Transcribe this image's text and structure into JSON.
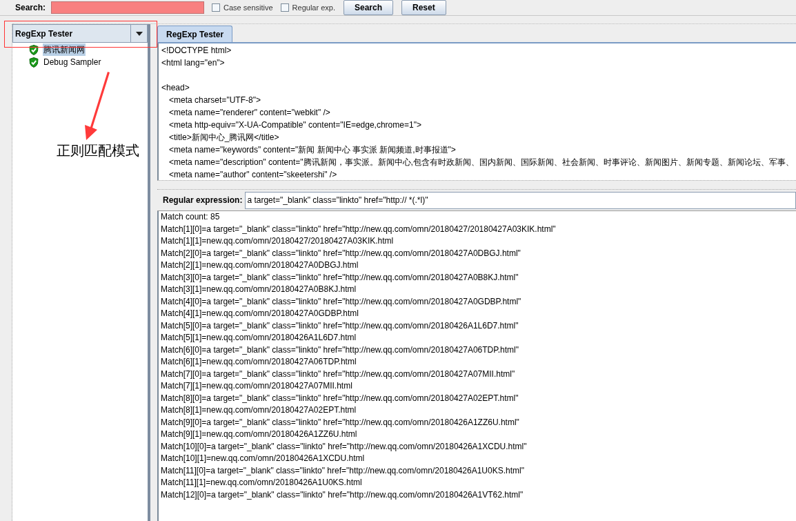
{
  "search": {
    "label": "Search:",
    "options": [
      {
        "label": "Case sensitive",
        "checked": false
      },
      {
        "label": "Regular exp.",
        "checked": false
      }
    ],
    "buttons": [
      "Search",
      "Reset"
    ]
  },
  "view_selector": {
    "value": "RegExp Tester"
  },
  "tree": [
    {
      "label": "腾讯新闻网",
      "selected": true
    },
    {
      "label": "Debug Sampler",
      "selected": false
    }
  ],
  "tabs": [
    {
      "label": "RegExp Tester",
      "selected": true
    }
  ],
  "response": {
    "blocks": [
      [
        {
          "text": "<!DOCTYPE html>",
          "indented": false
        },
        {
          "text": "<html lang=\"en\">",
          "indented": false
        }
      ],
      [
        {
          "text": "<head>",
          "indented": false
        },
        {
          "text": "<meta charset=\"UTF-8\">",
          "indented": true
        },
        {
          "text": "<meta name=\"renderer\" content=\"webkit\" />",
          "indented": true
        },
        {
          "text": "<meta http-equiv=\"X-UA-Compatible\" content=\"IE=edge,chrome=1\">",
          "indented": true
        },
        {
          "text": "<title>新闻中心_腾讯网</title>",
          "indented": true
        },
        {
          "text": "<meta name=\"keywords\" content=\"新闻 新闻中心 事实派 新闻频道,时事报道\">",
          "indented": true
        },
        {
          "text": "<meta name=\"description\" content=\"腾讯新闻，事实派。新闻中心,包含有时政新闻、国内新闻、国际新闻、社会新闻、时事评论、新闻图片、新闻专题、新闻论坛、军事、",
          "indented": true
        },
        {
          "text": "<meta name=\"author\" content=\"skeetershi\" />",
          "indented": true
        }
      ]
    ]
  },
  "regex": {
    "label": "Regular expression:",
    "value": "a target=\"_blank\" class=\"linkto\" href=\"http:// *(.*l)\""
  },
  "results": [
    "Match count: 85",
    "Match[1][0]=a target=\"_blank\" class=\"linkto\" href=\"http://new.qq.com/omn/20180427/20180427A03KIK.html\"",
    "Match[1][1]=new.qq.com/omn/20180427/20180427A03KIK.html",
    "Match[2][0]=a target=\"_blank\" class=\"linkto\" href=\"http://new.qq.com/omn/20180427A0DBGJ.html\"",
    "Match[2][1]=new.qq.com/omn/20180427A0DBGJ.html",
    "Match[3][0]=a target=\"_blank\" class=\"linkto\" href=\"http://new.qq.com/omn/20180427A0B8KJ.html\"",
    "Match[3][1]=new.qq.com/omn/20180427A0B8KJ.html",
    "Match[4][0]=a target=\"_blank\" class=\"linkto\" href=\"http://new.qq.com/omn/20180427A0GDBP.html\"",
    "Match[4][1]=new.qq.com/omn/20180427A0GDBP.html",
    "Match[5][0]=a target=\"_blank\" class=\"linkto\" href=\"http://new.qq.com/omn/20180426A1L6D7.html\"",
    "Match[5][1]=new.qq.com/omn/20180426A1L6D7.html",
    "Match[6][0]=a target=\"_blank\" class=\"linkto\" href=\"http://new.qq.com/omn/20180427A06TDP.html\"",
    "Match[6][1]=new.qq.com/omn/20180427A06TDP.html",
    "Match[7][0]=a target=\"_blank\" class=\"linkto\" href=\"http://new.qq.com/omn/20180427A07MII.html\"",
    "Match[7][1]=new.qq.com/omn/20180427A07MII.html",
    "Match[8][0]=a target=\"_blank\" class=\"linkto\" href=\"http://new.qq.com/omn/20180427A02EPT.html\"",
    "Match[8][1]=new.qq.com/omn/20180427A02EPT.html",
    "Match[9][0]=a target=\"_blank\" class=\"linkto\" href=\"http://new.qq.com/omn/20180426A1ZZ6U.html\"",
    "Match[9][1]=new.qq.com/omn/20180426A1ZZ6U.html",
    "Match[10][0]=a target=\"_blank\" class=\"linkto\" href=\"http://new.qq.com/omn/20180426A1XCDU.html\"",
    "Match[10][1]=new.qq.com/omn/20180426A1XCDU.html",
    "Match[11][0]=a target=\"_blank\" class=\"linkto\" href=\"http://new.qq.com/omn/20180426A1U0KS.html\"",
    "Match[11][1]=new.qq.com/omn/20180426A1U0KS.html",
    "Match[12][0]=a target=\"_blank\" class=\"linkto\" href=\"http://new.qq.com/omn/20180426A1VT62.html\""
  ],
  "annotation": {
    "text": "正则匹配模式"
  }
}
